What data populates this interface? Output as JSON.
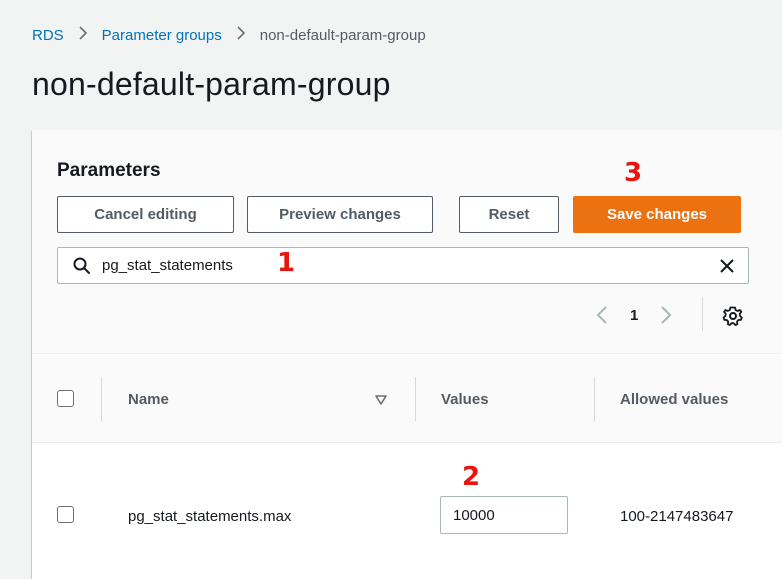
{
  "breadcrumb": {
    "items": [
      "RDS",
      "Parameter groups",
      "non-default-param-group"
    ],
    "separator": ">"
  },
  "page_title": "non-default-param-group",
  "panel": {
    "title": "Parameters",
    "buttons": {
      "cancel": "Cancel editing",
      "preview": "Preview changes",
      "reset": "Reset",
      "save": "Save changes"
    },
    "search": {
      "value": "pg_stat_statements",
      "placeholder": ""
    },
    "pagination": {
      "current_page": "1"
    }
  },
  "table": {
    "columns": [
      "Name",
      "Values",
      "Allowed values"
    ],
    "rows": [
      {
        "name": "pg_stat_statements.max",
        "value": "10000",
        "allowed": "100-2147483647"
      }
    ]
  },
  "annotations": [
    "1",
    "2",
    "3"
  ],
  "colors": {
    "accent": "#ec7211",
    "link": "#0073bb",
    "annotation": "#e8140f"
  }
}
